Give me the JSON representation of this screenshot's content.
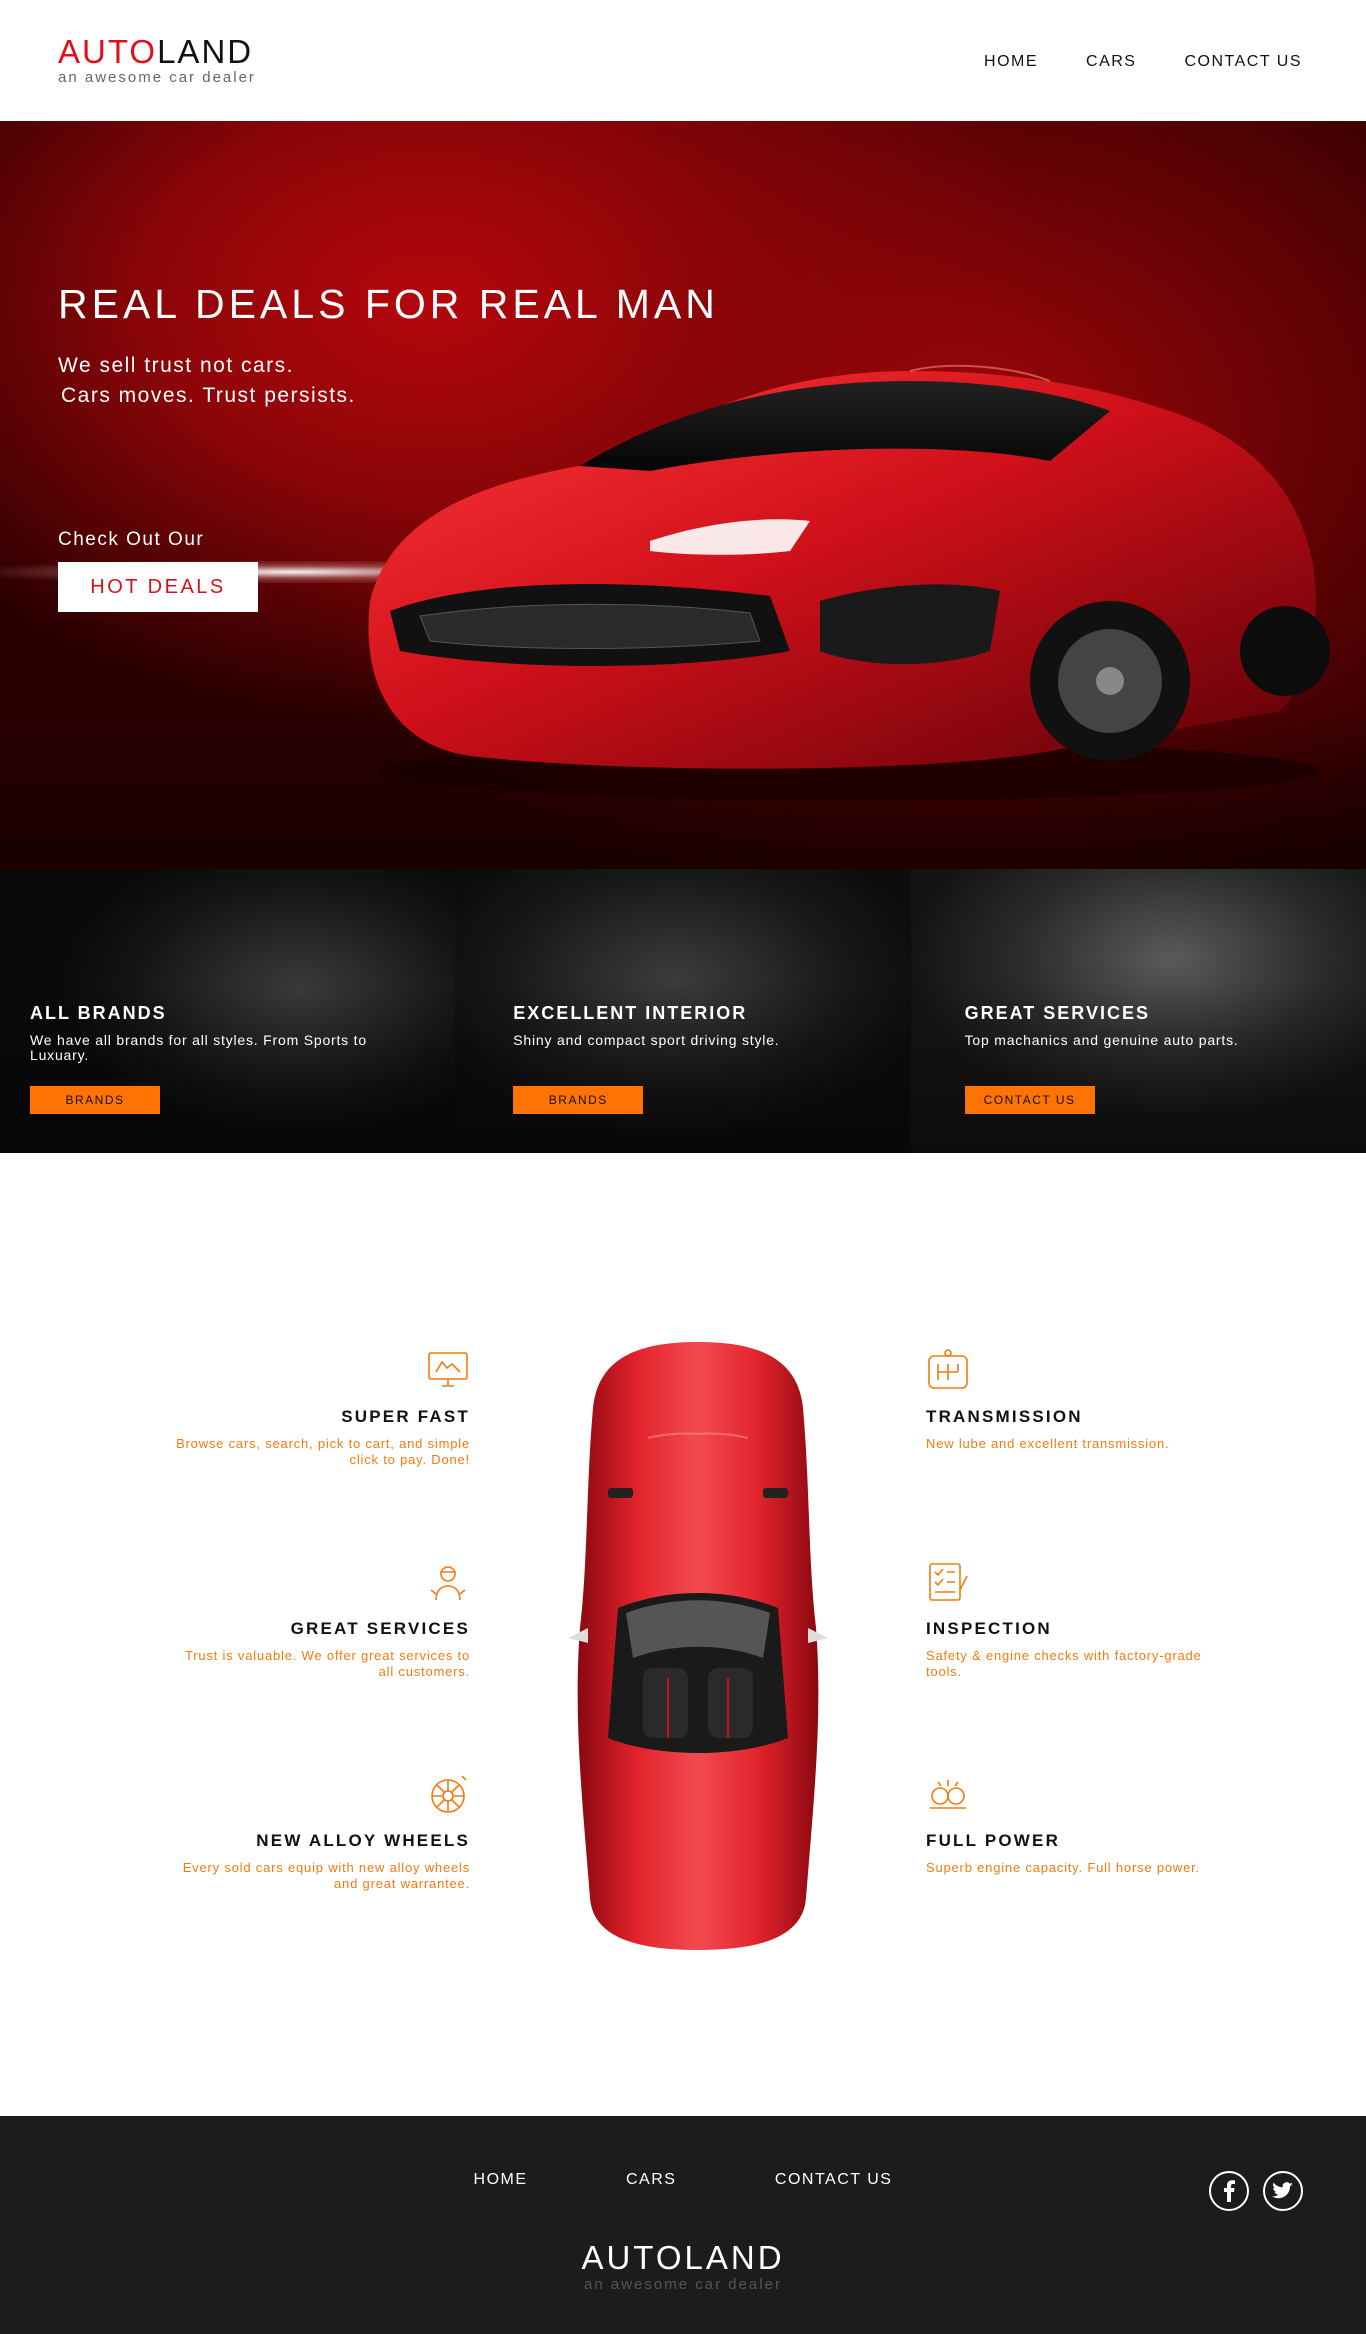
{
  "header": {
    "logo_part1": "AUTO",
    "logo_part2": "LAND",
    "tagline": "an awesome car dealer",
    "nav": [
      "HOME",
      "CARS",
      "CONTACT US"
    ]
  },
  "hero": {
    "title": "REAL DEALS FOR REAL MAN",
    "subtitle_line1": "We sell trust not cars.",
    "subtitle_line2": "Cars moves. Trust persists.",
    "cta_caption": "Check Out Our",
    "cta_button": "HOT DEALS"
  },
  "tiles": [
    {
      "title": "ALL BRANDS",
      "text": "We have all brands for all styles. From Sports to Luxuary.",
      "button": "BRANDS"
    },
    {
      "title": "EXCELLENT INTERIOR",
      "text": "Shiny and compact sport driving style.",
      "button": "BRANDS"
    },
    {
      "title": "GREAT SERVICES",
      "text": "Top machanics and genuine auto parts.",
      "button": "CONTACT US"
    }
  ],
  "features": {
    "left": [
      {
        "icon": "computer-icon",
        "title": "SUPER FAST",
        "text": "Browse cars, search, pick to cart, and simple click to pay. Done!"
      },
      {
        "icon": "mechanic-icon",
        "title": "GREAT SERVICES",
        "text": "Trust is valuable. We offer great services to all customers."
      },
      {
        "icon": "wheel-icon",
        "title": "NEW ALLOY WHEELS",
        "text": "Every sold cars equip with new alloy wheels and great warrantee."
      }
    ],
    "right": [
      {
        "icon": "gearbox-icon",
        "title": "TRANSMISSION",
        "text": "New lube and excellent transmission."
      },
      {
        "icon": "checklist-icon",
        "title": "INSPECTION",
        "text": "Safety & engine checks with factory-grade tools."
      },
      {
        "icon": "engine-icon",
        "title": "FULL POWER",
        "text": "Superb engine capacity. Full horse power."
      }
    ]
  },
  "footer": {
    "nav": [
      "HOME",
      "CARS",
      "CONTACT US"
    ],
    "logo": "AUTOLAND",
    "tagline": "an awesome car dealer",
    "social": [
      "facebook-icon",
      "twitter-icon"
    ]
  },
  "colors": {
    "brand_red": "#e0101a",
    "accent_orange": "#fe7301",
    "footer_bg": "#1c1c1c"
  }
}
